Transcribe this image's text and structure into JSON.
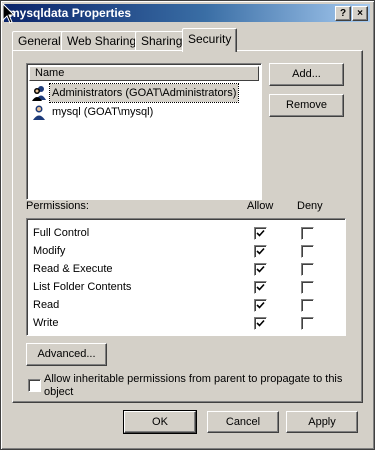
{
  "window": {
    "title": "mysqldata Properties",
    "help_btn": "?",
    "close_btn": "×"
  },
  "tabs": [
    {
      "label": "General",
      "active": false
    },
    {
      "label": "Web Sharing",
      "active": false
    },
    {
      "label": "Sharing",
      "active": false
    },
    {
      "label": "Security",
      "active": true
    }
  ],
  "names": {
    "header": "Name",
    "rows": [
      {
        "label": "Administrators (GOAT\\Administrators)",
        "icon": "group-users-icon",
        "selected": true
      },
      {
        "label": "mysql (GOAT\\mysql)",
        "icon": "user-icon",
        "selected": false
      }
    ]
  },
  "buttons": {
    "add": "Add...",
    "remove": "Remove",
    "advanced": "Advanced...",
    "ok": "OK",
    "cancel": "Cancel",
    "apply": "Apply"
  },
  "permissions": {
    "label": "Permissions:",
    "allow_label": "Allow",
    "deny_label": "Deny",
    "rows": [
      {
        "label": "Full Control",
        "allow": true,
        "deny": false
      },
      {
        "label": "Modify",
        "allow": true,
        "deny": false
      },
      {
        "label": "Read & Execute",
        "allow": true,
        "deny": false
      },
      {
        "label": "List Folder Contents",
        "allow": true,
        "deny": false
      },
      {
        "label": "Read",
        "allow": true,
        "deny": false
      },
      {
        "label": "Write",
        "allow": true,
        "deny": false
      }
    ]
  },
  "inherit": {
    "label_line1": "Allow inheritable permissions from parent to propagate to this",
    "label_line2": "object",
    "checked": false
  }
}
